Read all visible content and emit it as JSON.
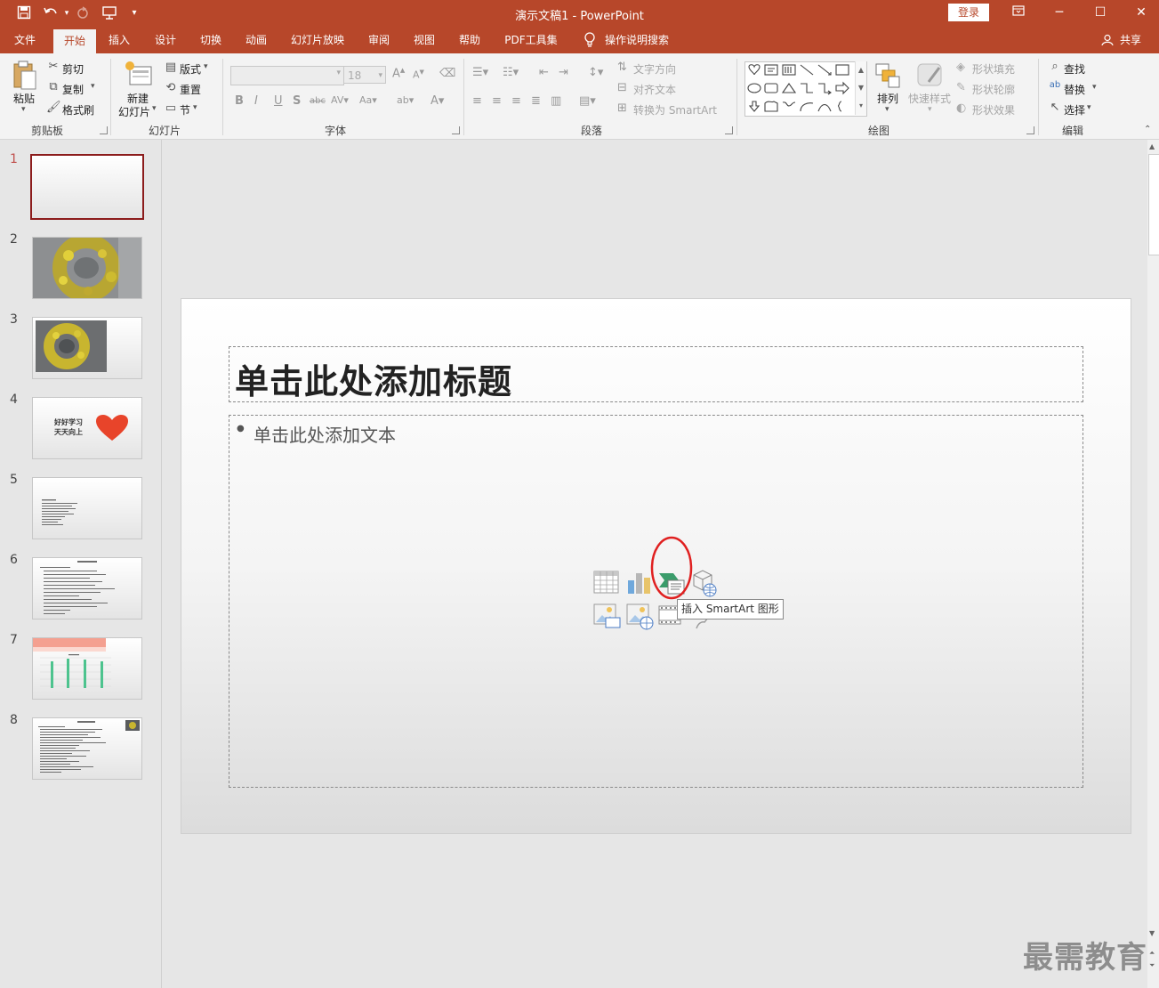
{
  "window": {
    "title": "演示文稿1  -  PowerPoint",
    "login_label": "登录",
    "share_label": "共享",
    "qat_icons": [
      "save-icon",
      "undo-icon",
      "redo-icon",
      "start-from-beginning-icon",
      "customize-qat-icon"
    ]
  },
  "tabs": [
    "文件",
    "开始",
    "插入",
    "设计",
    "切换",
    "动画",
    "幻灯片放映",
    "审阅",
    "视图",
    "帮助",
    "PDF工具集",
    "操作说明搜索"
  ],
  "active_tab": "开始",
  "ribbon": {
    "clipboard": {
      "paste": "粘贴",
      "cut": "剪切",
      "copy": "复制",
      "format_painter": "格式刷",
      "label": "剪贴板"
    },
    "slides": {
      "new_slide_line1": "新建",
      "new_slide_line2": "幻灯片",
      "layout": "版式",
      "reset": "重置",
      "section": "节",
      "label": "幻灯片"
    },
    "font": {
      "font_name": "",
      "font_size": "18",
      "label": "字体"
    },
    "paragraph": {
      "text_direction": "文字方向",
      "align_text": "对齐文本",
      "convert_smartart": "转换为 SmartArt",
      "label": "段落"
    },
    "drawing": {
      "arrange": "排列",
      "quick_styles": "快速样式",
      "shape_fill": "形状填充",
      "shape_outline": "形状轮廓",
      "shape_effects": "形状效果",
      "label": "绘图"
    },
    "editing": {
      "find": "查找",
      "replace": "替换",
      "select": "选择",
      "label": "编辑"
    }
  },
  "thumbnails": [
    {
      "num": "1",
      "kind": "blank",
      "selected": true
    },
    {
      "num": "2",
      "kind": "photo-full",
      "selected": false
    },
    {
      "num": "3",
      "kind": "photo-left",
      "selected": false
    },
    {
      "num": "4",
      "kind": "text-heart",
      "selected": false,
      "line1": "好好学习",
      "line2": "天天向上"
    },
    {
      "num": "5",
      "kind": "text-list",
      "selected": false
    },
    {
      "num": "6",
      "kind": "text-list-title",
      "selected": false
    },
    {
      "num": "7",
      "kind": "chart-table",
      "selected": false
    },
    {
      "num": "8",
      "kind": "text-list-photo",
      "selected": false
    }
  ],
  "slide": {
    "title_placeholder": "单击此处添加标题",
    "body_placeholder": "单击此处添加文本",
    "content_icons": [
      "insert-table-icon",
      "insert-chart-icon",
      "insert-smartart-icon",
      "insert-3d-model-icon",
      "insert-pictures-icon",
      "insert-online-pictures-icon",
      "insert-video-icon",
      "insert-icons-icon"
    ]
  },
  "tooltip": "插入 SmartArt 图形",
  "watermark": "最需教育",
  "colors": {
    "accent": "#b7472a",
    "highlight": "#e02020",
    "selected_border": "#8c1c1c"
  }
}
